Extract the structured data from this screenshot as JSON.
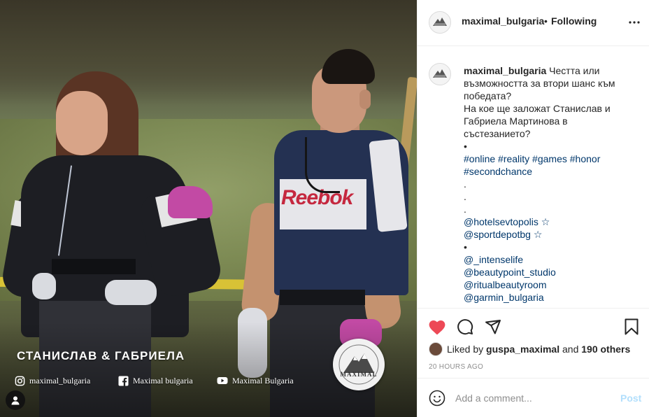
{
  "photo": {
    "overlay_title": "СТАНИСЛАВ & ГАБРИЕЛА",
    "shirt_logo": "Reebok",
    "social": [
      {
        "icon": "instagram-icon",
        "label": "maximal_bulgaria"
      },
      {
        "icon": "facebook-icon",
        "label": "Maximal bulgaria"
      },
      {
        "icon": "youtube-icon",
        "label": "Maximal Bulgaria"
      }
    ],
    "badge_text": "MAXIMAL"
  },
  "header": {
    "username": "maximal_bulgaria",
    "separator": "•",
    "follow_status": "Following"
  },
  "caption": {
    "username": "maximal_bulgaria",
    "lines": [
      "Честта или",
      "възможността за втори шанс към",
      "победата?",
      "На кое ще заложат Станислав и",
      "Габриела Мартинова в",
      "състезанието?",
      "•",
      "#online #reality #games #honor",
      "#secondchance",
      ".",
      ".",
      ".",
      "@hotelsevtopolis ☆",
      "@sportdepotbg ☆",
      "•",
      "@_intenselife",
      "@beautypoint_studio",
      "@ritualbeautyroom",
      "@garmin_bulgaria"
    ]
  },
  "likes": {
    "prefix": "Liked by",
    "user": "guspa_maximal",
    "middle": "and",
    "others": "190 others"
  },
  "timestamp": "20 HOURS AGO",
  "comment": {
    "placeholder": "Add a comment...",
    "post_label": "Post"
  },
  "colors": {
    "like_red": "#ed4956",
    "post_disabled": "#b2dffc",
    "tag_blue": "#00376b",
    "secondary_text": "#8e8e8e"
  }
}
